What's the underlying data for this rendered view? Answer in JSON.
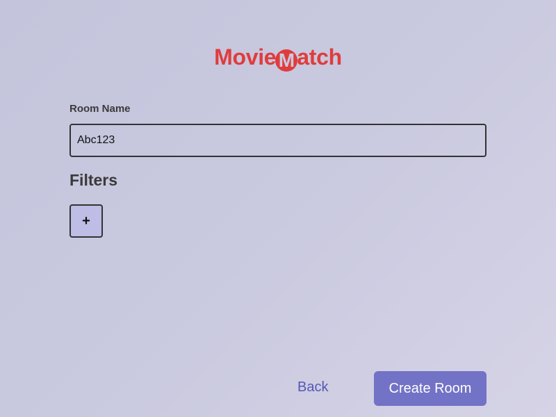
{
  "logo": {
    "part1": "Movie",
    "circle_letter": "M",
    "part2": "atch"
  },
  "form": {
    "room_name_label": "Room Name",
    "room_name_value": "Abc123"
  },
  "filters": {
    "heading": "Filters",
    "add_label": "+"
  },
  "actions": {
    "back_label": "Back",
    "create_label": "Create Room"
  },
  "colors": {
    "brand": "#e03c3c",
    "accent": "#7272c6",
    "link": "#5656b8"
  }
}
